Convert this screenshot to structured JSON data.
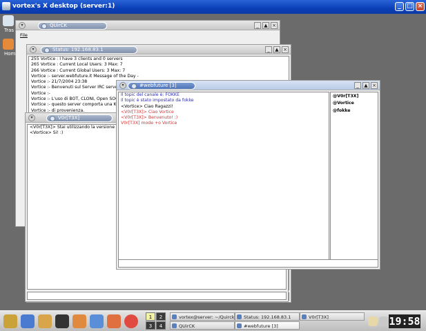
{
  "outer_window": {
    "title": "vortex's X desktop (server:1)"
  },
  "desktop": {
    "icons": [
      {
        "label": "Tras"
      },
      {
        "label": "Hom"
      }
    ]
  },
  "quirck_window": {
    "title": "QUirCK",
    "menu_file": "File"
  },
  "status_window": {
    "title": "Status: 192.168.83.1",
    "lines": [
      "255 Vortice : I have 3 clients and 0 servers",
      "265 Vortice : Current Local Users: 3  Max: 7",
      "266 Vortice : Current Global Users: 3  Max: 7",
      "Vortice :- server.webfuture.it Message of the Day -",
      "Vortice :- 21/7/2004 23:38",
      "Vortice :- Benvenuti sul Server IRC server.web",
      "Vortice :-",
      "Vortice :- L'uso di BOT, CLONI, Open SOCKS",
      "Vortice :- questo server comporta una K-line s",
      "Vortice :- di provenienza.",
      "Vortice :-"
    ]
  },
  "query_window": {
    "title": "V0r[T3X]",
    "lines": [
      "<V0r[T3X]> Stai utilizzando la versione finale d",
      "<Vortice> Si! :)"
    ]
  },
  "channel_window": {
    "title": "#webfuture [3]",
    "lines": [
      {
        "text": "Il topic del canale è: FOKKE",
        "color": "blue"
      },
      {
        "text": "Il topic è stato impostato da fokke",
        "color": "blue"
      },
      {
        "text": "<Vortice> Ciao Ragazzi!",
        "color": "black"
      },
      {
        "text": "<V0r[T3X]> Ciao Vortice",
        "color": "red"
      },
      {
        "text": "<V0r[T3X]> Benvenuto! :)",
        "color": "red"
      },
      {
        "text": "V0r[T3X] mode +o Vortice",
        "color": "red"
      }
    ],
    "users": [
      "@V0r[T3X]",
      "@Vortice",
      "@fokke"
    ]
  },
  "taskbar": {
    "desktops": [
      "1",
      "2",
      "3",
      "4"
    ],
    "tasks": [
      {
        "label": "vortex@server: ~/Quirck"
      },
      {
        "label": "Status: 192.168.83.1"
      },
      {
        "label": "V0r[T3X]"
      },
      {
        "label": "QUirCK"
      },
      {
        "label": "#webfuture [3]"
      }
    ],
    "clock": "19:58"
  },
  "colors": {
    "title_blue": "#0a3fb8",
    "irc_blue": "#2a2ab8",
    "irc_red": "#d83030"
  }
}
